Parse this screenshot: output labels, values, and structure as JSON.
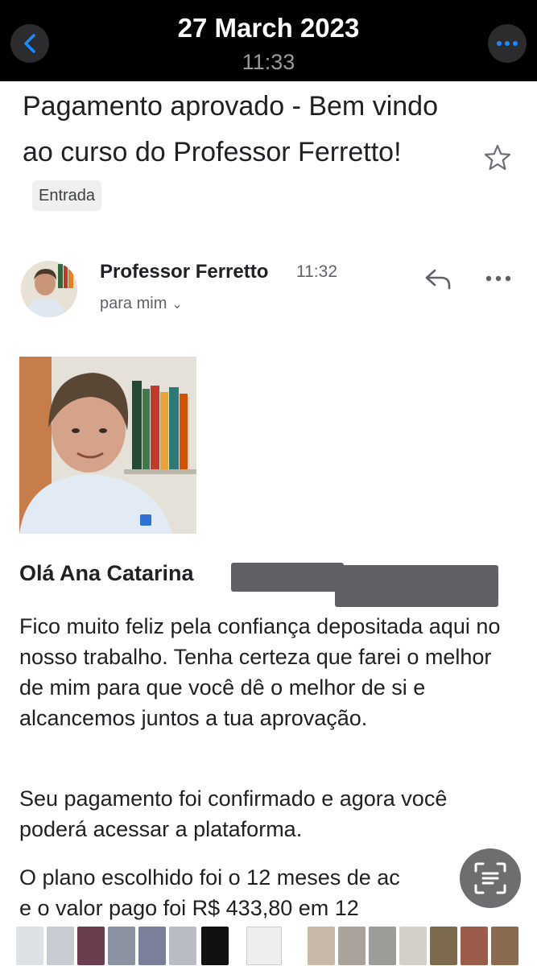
{
  "header": {
    "date": "27 March 2023",
    "time": "11:33",
    "back_icon": "chevron-left-icon",
    "more_icon": "ellipsis-icon"
  },
  "email": {
    "subject": "Pagamento aprovado - Bem vindo ao curso do Professor Ferretto!",
    "label": "Entrada",
    "sender": "Professor Ferretto",
    "sent_time": "11:32",
    "recipient": "para mim",
    "greeting": "Olá Ana Catarina",
    "paragraphs": [
      "Fico muito feliz pela confiança depositada aqui no nosso trabalho. Tenha certeza que farei o melhor de mim para que você dê o melhor de si e alcancemos juntos a tua aprovação.",
      "Seu pagamento foi confirmado e agora você poderá acessar a plataforma."
    ],
    "partial_lines": [
      "O plano escolhido foi o 12 meses de ac",
      "e o valor pago foi R$ 433,80 em 12"
    ]
  },
  "colors": {
    "header_bg": "#000000",
    "accent_blue": "#1a73e8",
    "redaction": "#5f6063",
    "badge_bg": "#efefef"
  }
}
